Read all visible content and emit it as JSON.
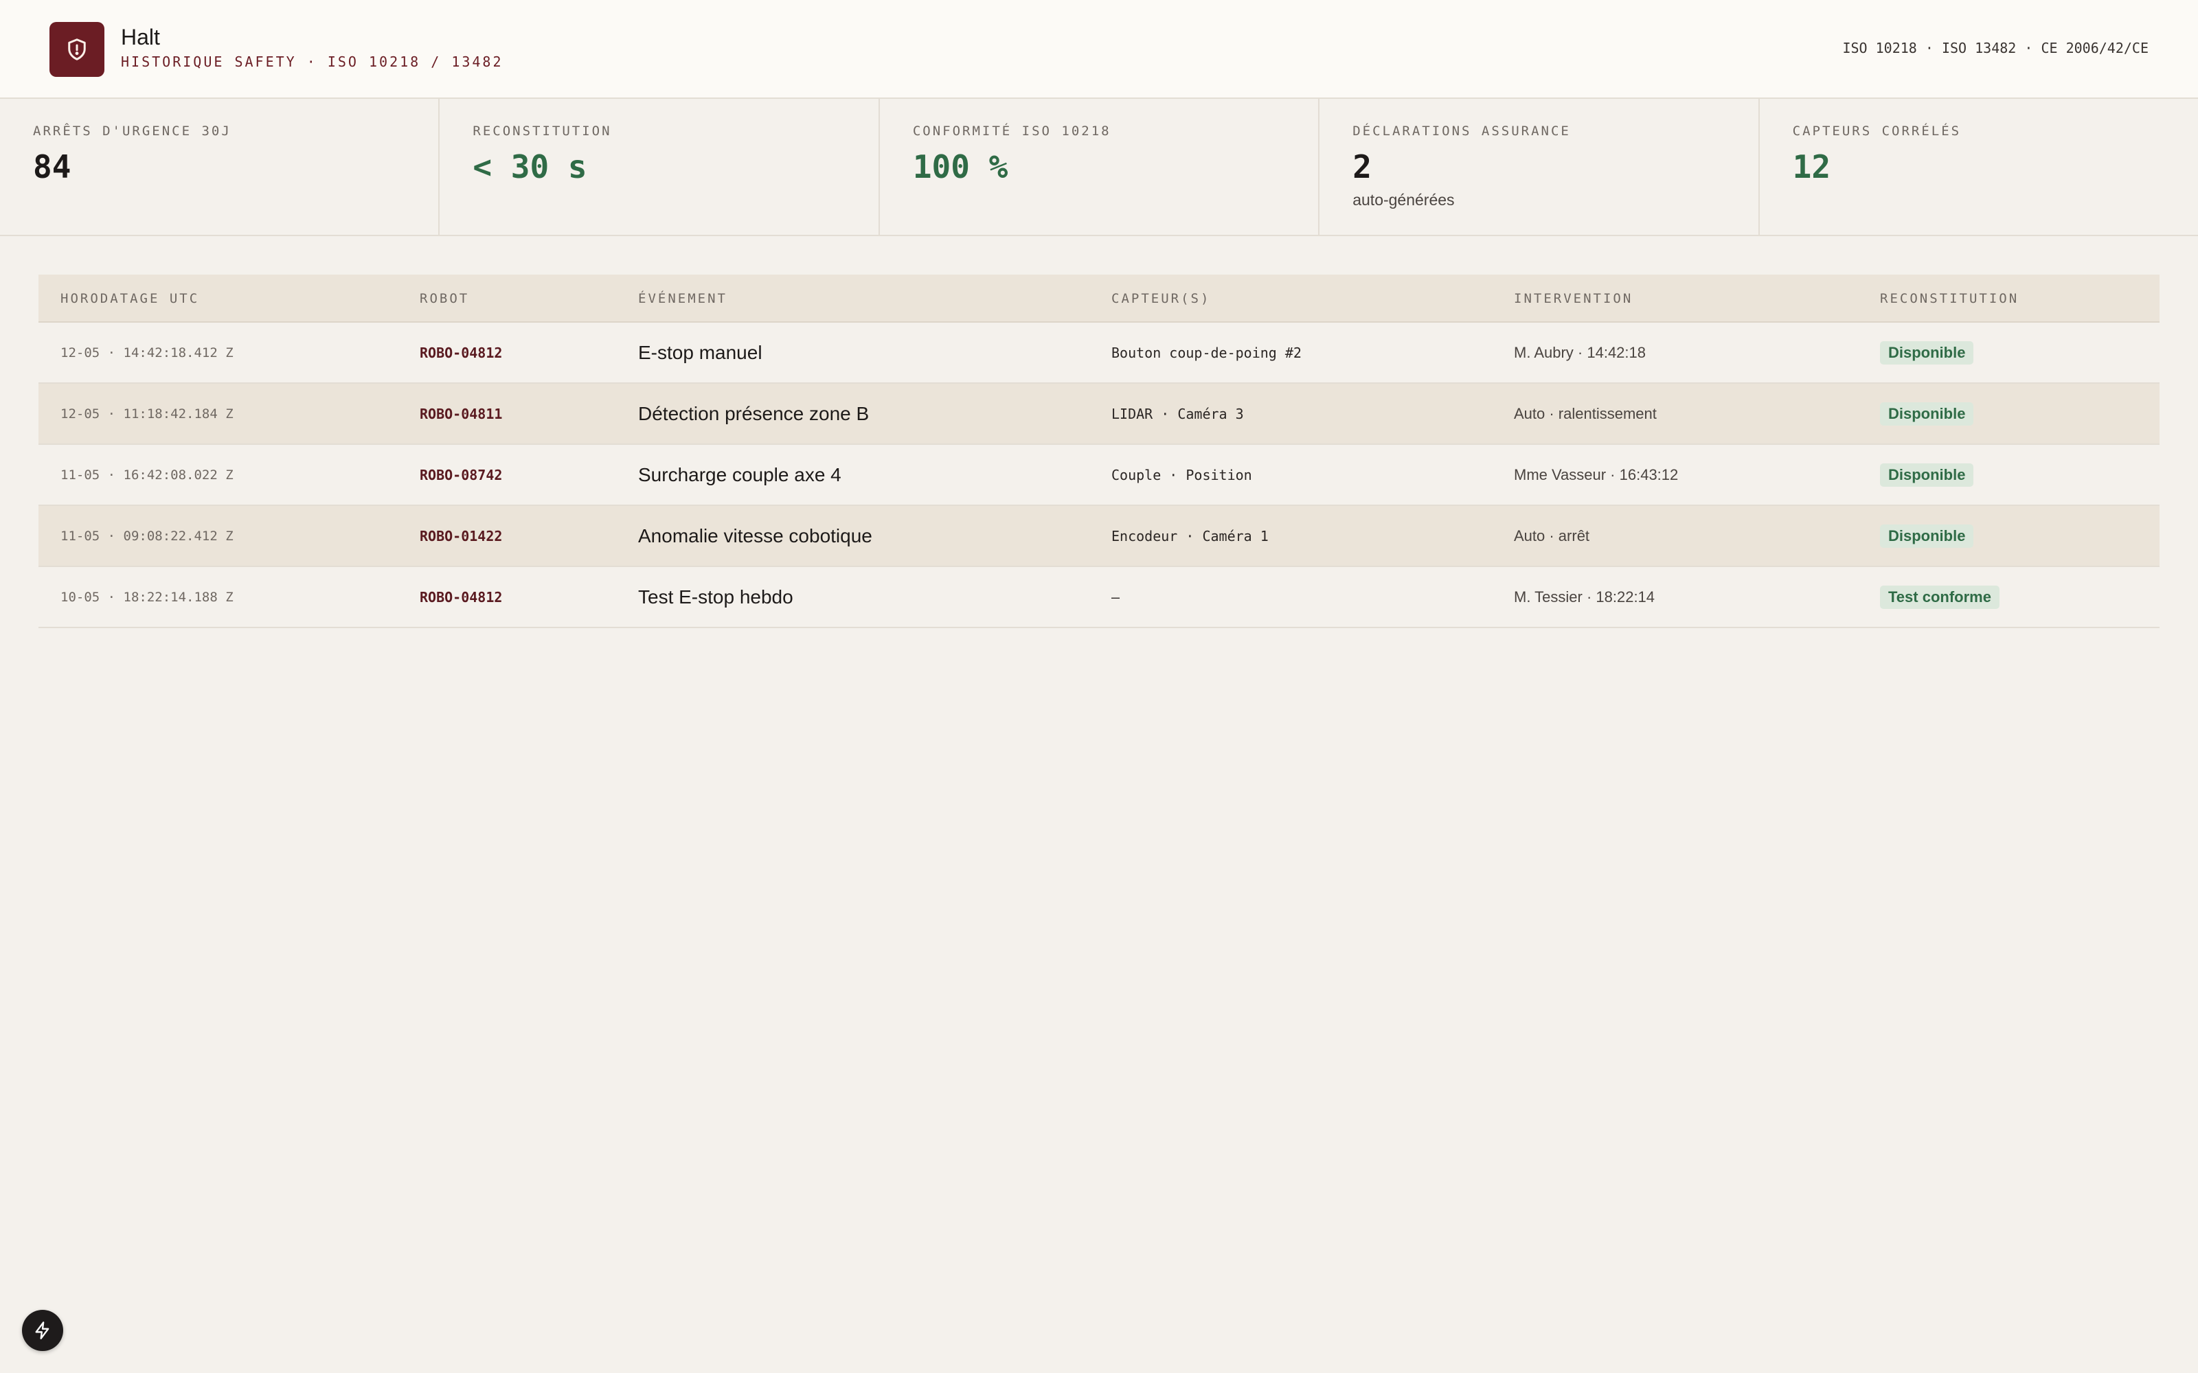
{
  "app": {
    "title": "Halt",
    "subtitle": "HISTORIQUE SAFETY · ISO 10218 / 13482",
    "standards": "ISO 10218 · ISO 13482 · CE 2006/42/CE",
    "logo_icon": "shield-alert-icon"
  },
  "stats": [
    {
      "label": "ARRÊTS D'URGENCE 30J",
      "value": "84",
      "sub": ""
    },
    {
      "label": "RECONSTITUTION",
      "value": "< 30 s",
      "sub": ""
    },
    {
      "label": "CONFORMITÉ ISO 10218",
      "value": "100 %",
      "sub": ""
    },
    {
      "label": "DÉCLARATIONS ASSURANCE",
      "value": "2",
      "sub": "auto-générées"
    },
    {
      "label": "CAPTEURS CORRÉLÉS",
      "value": "12",
      "sub": ""
    }
  ],
  "table": {
    "headers": {
      "timestamp": "HORODATAGE UTC",
      "robot": "ROBOT",
      "event": "ÉVÉNEMENT",
      "sensors": "CAPTEUR(S)",
      "intervention": "INTERVENTION",
      "reconstitution": "RECONSTITUTION"
    },
    "rows": [
      {
        "timestamp": "12-05 · 14:42:18.412 Z",
        "robot": "ROBO-04812",
        "event": "E-stop manuel",
        "sensors": "Bouton coup-de-poing #2",
        "intervention": "M. Aubry · 14:42:18",
        "status": "Disponible"
      },
      {
        "timestamp": "12-05 · 11:18:42.184 Z",
        "robot": "ROBO-04811",
        "event": "Détection présence zone B",
        "sensors": "LIDAR · Caméra 3",
        "intervention": "Auto · ralentissement",
        "status": "Disponible"
      },
      {
        "timestamp": "11-05 · 16:42:08.022 Z",
        "robot": "ROBO-08742",
        "event": "Surcharge couple axe 4",
        "sensors": "Couple · Position",
        "intervention": "Mme Vasseur · 16:43:12",
        "status": "Disponible"
      },
      {
        "timestamp": "11-05 · 09:08:22.412 Z",
        "robot": "ROBO-01422",
        "event": "Anomalie vitesse cobotique",
        "sensors": "Encodeur · Caméra 1",
        "intervention": "Auto · arrêt",
        "status": "Disponible"
      },
      {
        "timestamp": "10-05 · 18:22:14.188 Z",
        "robot": "ROBO-04812",
        "event": "Test E-stop hebdo",
        "sensors": "–",
        "intervention": "M. Tessier · 18:22:14",
        "status": "Test conforme"
      }
    ]
  },
  "fab": {
    "icon": "lightning-icon"
  },
  "colors": {
    "brand": "#6b1d24",
    "positive": "#2f6b46",
    "badge_bg": "#dce8dc",
    "background": "#f4f1ec"
  }
}
